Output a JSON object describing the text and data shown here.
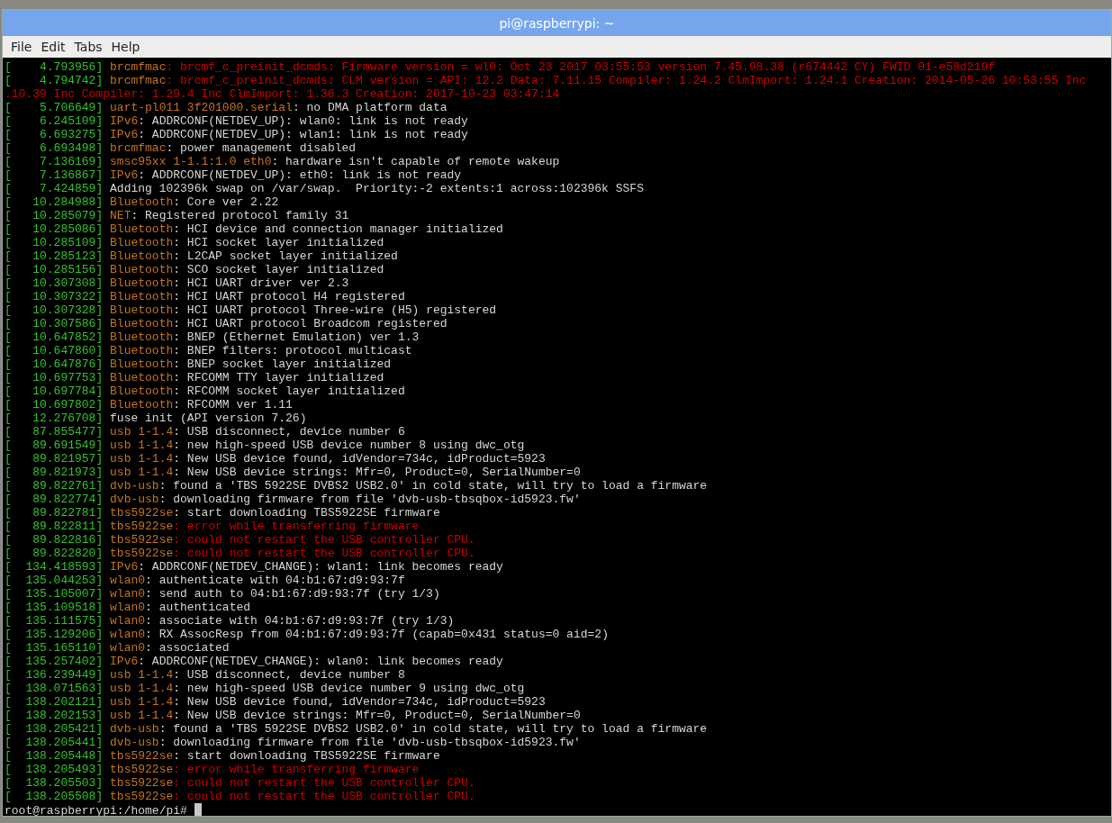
{
  "window": {
    "title": "pi@raspberrypi: ~"
  },
  "menu": [
    "File",
    "Edit",
    "Tabs",
    "Help"
  ],
  "lines": [
    {
      "kind": "entry",
      "time": "[    4.793956]",
      "source": "brcmfmac",
      "message": ": brcmf_c_preinit_dcmds: Firmware version = wl0: Oct 23 2017 03:55:53 version 7.45.98.38 (r674442 CY) FWID 01-e58d219f",
      "error": true
    },
    {
      "kind": "entry",
      "time": "[    4.794742]",
      "source": "brcmfmac",
      "message": ": brcmf_c_preinit_dcmds: CLM version = API: 12.2 Data: 7.11.15 Compiler: 1.24.2 ClmImport: 1.24.1 Creation: 2014-05-26 10:53:55 Inc",
      "error": true
    },
    {
      "kind": "continuation",
      "message": ".10.39 Inc Compiler: 1.29.4 Inc ClmImport: 1.36.3 Creation: 2017-10-23 03:47:14",
      "error": true
    },
    {
      "kind": "entry",
      "time": "[    5.706649]",
      "source": "uart-pl011 3f201000.serial",
      "message": ": no DMA platform data",
      "error": false
    },
    {
      "kind": "entry",
      "time": "[    6.245109]",
      "source": "IPv6",
      "message": ": ADDRCONF(NETDEV_UP): wlan0: link is not ready",
      "error": false
    },
    {
      "kind": "entry",
      "time": "[    6.693275]",
      "source": "IPv6",
      "message": ": ADDRCONF(NETDEV_UP): wlan1: link is not ready",
      "error": false
    },
    {
      "kind": "entry",
      "time": "[    6.693498]",
      "source": "brcmfmac",
      "message": ": power management disabled",
      "error": false
    },
    {
      "kind": "entry",
      "time": "[    7.136169]",
      "source": "smsc95xx 1-1.1:1.0 eth0",
      "message": ": hardware isn't capable of remote wakeup",
      "error": false
    },
    {
      "kind": "entry",
      "time": "[    7.136867]",
      "source": "IPv6",
      "message": ": ADDRCONF(NETDEV_UP): eth0: link is not ready",
      "error": false
    },
    {
      "kind": "entry",
      "time": "[    7.424859]",
      "message": "Adding 102396k swap on /var/swap.  Priority:-2 extents:1 across:102396k SSFS",
      "error": false
    },
    {
      "kind": "entry",
      "time": "[   10.284988]",
      "source": "Bluetooth",
      "message": ": Core ver 2.22",
      "error": false
    },
    {
      "kind": "entry",
      "time": "[   10.285079]",
      "source": "NET",
      "message": ": Registered protocol family 31",
      "error": false
    },
    {
      "kind": "entry",
      "time": "[   10.285086]",
      "source": "Bluetooth",
      "message": ": HCI device and connection manager initialized",
      "error": false
    },
    {
      "kind": "entry",
      "time": "[   10.285109]",
      "source": "Bluetooth",
      "message": ": HCI socket layer initialized",
      "error": false
    },
    {
      "kind": "entry",
      "time": "[   10.285123]",
      "source": "Bluetooth",
      "message": ": L2CAP socket layer initialized",
      "error": false
    },
    {
      "kind": "entry",
      "time": "[   10.285156]",
      "source": "Bluetooth",
      "message": ": SCO socket layer initialized",
      "error": false
    },
    {
      "kind": "entry",
      "time": "[   10.307308]",
      "source": "Bluetooth",
      "message": ": HCI UART driver ver 2.3",
      "error": false
    },
    {
      "kind": "entry",
      "time": "[   10.307322]",
      "source": "Bluetooth",
      "message": ": HCI UART protocol H4 registered",
      "error": false
    },
    {
      "kind": "entry",
      "time": "[   10.307328]",
      "source": "Bluetooth",
      "message": ": HCI UART protocol Three-wire (H5) registered",
      "error": false
    },
    {
      "kind": "entry",
      "time": "[   10.307586]",
      "source": "Bluetooth",
      "message": ": HCI UART protocol Broadcom registered",
      "error": false
    },
    {
      "kind": "entry",
      "time": "[   10.647852]",
      "source": "Bluetooth",
      "message": ": BNEP (Ethernet Emulation) ver 1.3",
      "error": false
    },
    {
      "kind": "entry",
      "time": "[   10.647860]",
      "source": "Bluetooth",
      "message": ": BNEP filters: protocol multicast",
      "error": false
    },
    {
      "kind": "entry",
      "time": "[   10.647876]",
      "source": "Bluetooth",
      "message": ": BNEP socket layer initialized",
      "error": false
    },
    {
      "kind": "entry",
      "time": "[   10.697753]",
      "source": "Bluetooth",
      "message": ": RFCOMM TTY layer initialized",
      "error": false
    },
    {
      "kind": "entry",
      "time": "[   10.697784]",
      "source": "Bluetooth",
      "message": ": RFCOMM socket layer initialized",
      "error": false
    },
    {
      "kind": "entry",
      "time": "[   10.697802]",
      "source": "Bluetooth",
      "message": ": RFCOMM ver 1.11",
      "error": false
    },
    {
      "kind": "entry",
      "time": "[   12.276708]",
      "message": "fuse init (API version 7.26)",
      "error": false
    },
    {
      "kind": "entry",
      "time": "[   87.855477]",
      "source": "usb 1-1.4",
      "message": ": USB disconnect, device number 6",
      "error": false
    },
    {
      "kind": "entry",
      "time": "[   89.691549]",
      "source": "usb 1-1.4",
      "message": ": new high-speed USB device number 8 using dwc_otg",
      "error": false
    },
    {
      "kind": "entry",
      "time": "[   89.821957]",
      "source": "usb 1-1.4",
      "message": ": New USB device found, idVendor=734c, idProduct=5923",
      "error": false
    },
    {
      "kind": "entry",
      "time": "[   89.821973]",
      "source": "usb 1-1.4",
      "message": ": New USB device strings: Mfr=0, Product=0, SerialNumber=0",
      "error": false
    },
    {
      "kind": "entry",
      "time": "[   89.822761]",
      "source": "dvb-usb",
      "message": ": found a 'TBS 5922SE DVBS2 USB2.0' in cold state, will try to load a firmware",
      "error": false
    },
    {
      "kind": "entry",
      "time": "[   89.822774]",
      "source": "dvb-usb",
      "message": ": downloading firmware from file 'dvb-usb-tbsqbox-id5923.fw'",
      "error": false
    },
    {
      "kind": "entry",
      "time": "[   89.822781]",
      "source": "tbs5922se",
      "message": ": start downloading TBS5922SE firmware",
      "error": false
    },
    {
      "kind": "entry",
      "time": "[   89.822811]",
      "source": "tbs5922se",
      "message": ": error while transferring firmware",
      "error": true
    },
    {
      "kind": "entry",
      "time": "[   89.822816]",
      "source": "tbs5922se",
      "message": ": could not restart the USB controller CPU.",
      "error": true
    },
    {
      "kind": "entry",
      "time": "[   89.822820]",
      "source": "tbs5922se",
      "message": ": could not restart the USB controller CPU.",
      "error": true
    },
    {
      "kind": "entry",
      "time": "[  134.418593]",
      "source": "IPv6",
      "message": ": ADDRCONF(NETDEV_CHANGE): wlan1: link becomes ready",
      "error": false
    },
    {
      "kind": "entry",
      "time": "[  135.044253]",
      "source": "wlan0",
      "message": ": authenticate with 04:b1:67:d9:93:7f",
      "error": false
    },
    {
      "kind": "entry",
      "time": "[  135.105007]",
      "source": "wlan0",
      "message": ": send auth to 04:b1:67:d9:93:7f (try 1/3)",
      "error": false
    },
    {
      "kind": "entry",
      "time": "[  135.109518]",
      "source": "wlan0",
      "message": ": authenticated",
      "error": false
    },
    {
      "kind": "entry",
      "time": "[  135.111575]",
      "source": "wlan0",
      "message": ": associate with 04:b1:67:d9:93:7f (try 1/3)",
      "error": false
    },
    {
      "kind": "entry",
      "time": "[  135.129206]",
      "source": "wlan0",
      "message": ": RX AssocResp from 04:b1:67:d9:93:7f (capab=0x431 status=0 aid=2)",
      "error": false
    },
    {
      "kind": "entry",
      "time": "[  135.165110]",
      "source": "wlan0",
      "message": ": associated",
      "error": false
    },
    {
      "kind": "entry",
      "time": "[  135.257402]",
      "source": "IPv6",
      "message": ": ADDRCONF(NETDEV_CHANGE): wlan0: link becomes ready",
      "error": false
    },
    {
      "kind": "entry",
      "time": "[  136.239449]",
      "source": "usb 1-1.4",
      "message": ": USB disconnect, device number 8",
      "error": false
    },
    {
      "kind": "entry",
      "time": "[  138.071563]",
      "source": "usb 1-1.4",
      "message": ": new high-speed USB device number 9 using dwc_otg",
      "error": false
    },
    {
      "kind": "entry",
      "time": "[  138.202121]",
      "source": "usb 1-1.4",
      "message": ": New USB device found, idVendor=734c, idProduct=5923",
      "error": false
    },
    {
      "kind": "entry",
      "time": "[  138.202153]",
      "source": "usb 1-1.4",
      "message": ": New USB device strings: Mfr=0, Product=0, SerialNumber=0",
      "error": false
    },
    {
      "kind": "entry",
      "time": "[  138.205421]",
      "source": "dvb-usb",
      "message": ": found a 'TBS 5922SE DVBS2 USB2.0' in cold state, will try to load a firmware",
      "error": false
    },
    {
      "kind": "entry",
      "time": "[  138.205441]",
      "source": "dvb-usb",
      "message": ": downloading firmware from file 'dvb-usb-tbsqbox-id5923.fw'",
      "error": false
    },
    {
      "kind": "entry",
      "time": "[  138.205448]",
      "source": "tbs5922se",
      "message": ": start downloading TBS5922SE firmware",
      "error": false
    },
    {
      "kind": "entry",
      "time": "[  138.205493]",
      "source": "tbs5922se",
      "message": ": error while transferring firmware",
      "error": true
    },
    {
      "kind": "entry",
      "time": "[  138.205503]",
      "source": "tbs5922se",
      "message": ": could not restart the USB controller CPU.",
      "error": true
    },
    {
      "kind": "entry",
      "time": "[  138.205508]",
      "source": "tbs5922se",
      "message": ": could not restart the USB controller CPU.",
      "error": true
    }
  ],
  "prompt": "root@raspberrypi:/home/pi#"
}
